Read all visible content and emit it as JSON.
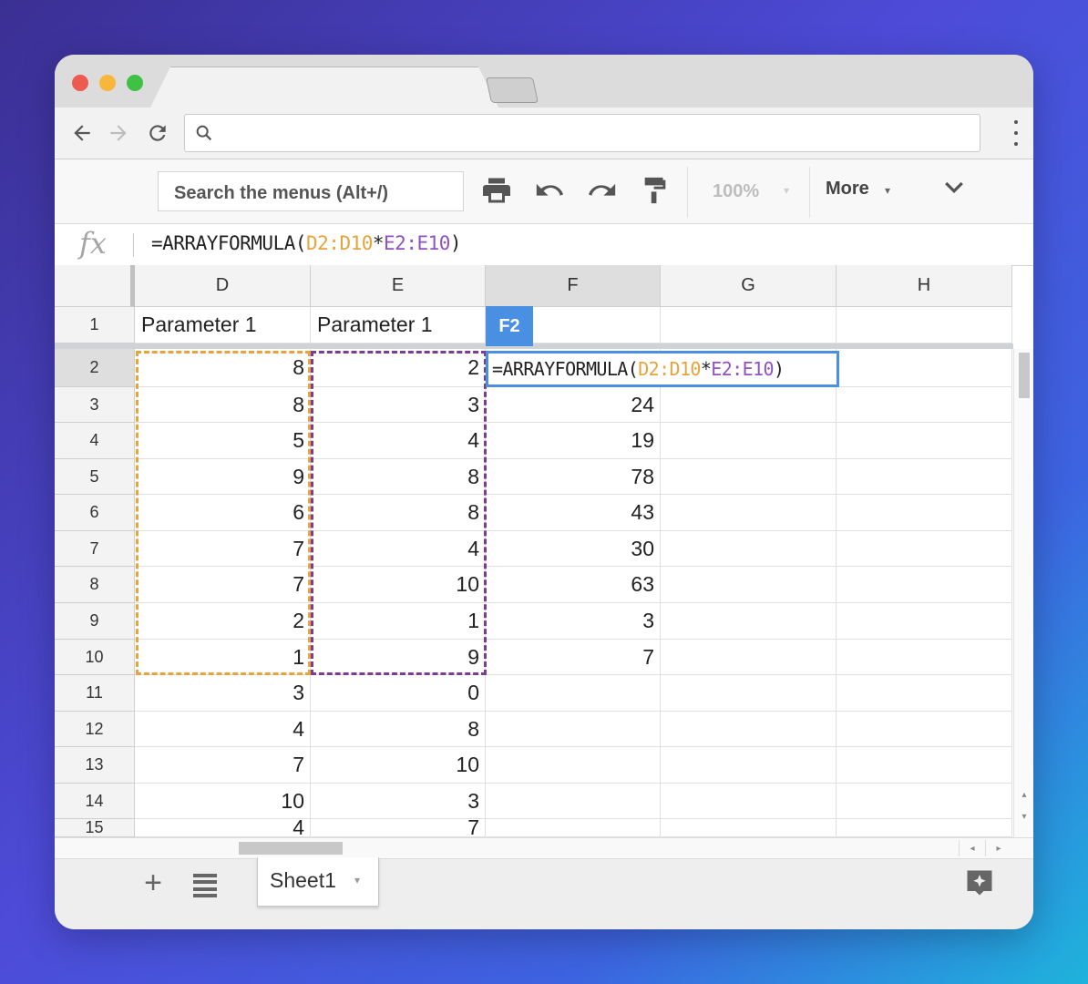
{
  "toolbar": {
    "menu_search_placeholder": "Search the menus (Alt+/)",
    "zoom": "100%",
    "more_label": "More"
  },
  "formula_bar": {
    "prefix": "=ARRAYFORMULA(",
    "range_a": "D2:D10",
    "operator": "*",
    "range_b": "E2:E10",
    "suffix": ")"
  },
  "columns": [
    "D",
    "E",
    "F",
    "G",
    "H"
  ],
  "selected_column": "F",
  "active_cell": "F2",
  "rows": [
    {
      "n": "1",
      "D": "Parameter 1",
      "E": "Parameter 1",
      "F": ""
    },
    {
      "n": "2",
      "D": "8",
      "E": "2",
      "F": ""
    },
    {
      "n": "3",
      "D": "8",
      "E": "3",
      "F": "24"
    },
    {
      "n": "4",
      "D": "5",
      "E": "4",
      "F": "19"
    },
    {
      "n": "5",
      "D": "9",
      "E": "8",
      "F": "78"
    },
    {
      "n": "6",
      "D": "6",
      "E": "8",
      "F": "43"
    },
    {
      "n": "7",
      "D": "7",
      "E": "4",
      "F": "30"
    },
    {
      "n": "8",
      "D": "7",
      "E": "10",
      "F": "63"
    },
    {
      "n": "9",
      "D": "2",
      "E": "1",
      "F": "3"
    },
    {
      "n": "10",
      "D": "1",
      "E": "9",
      "F": "7"
    },
    {
      "n": "11",
      "D": "3",
      "E": "0",
      "F": ""
    },
    {
      "n": "12",
      "D": "4",
      "E": "8",
      "F": ""
    },
    {
      "n": "13",
      "D": "7",
      "E": "10",
      "F": ""
    },
    {
      "n": "14",
      "D": "10",
      "E": "3",
      "F": ""
    },
    {
      "n": "15",
      "D": "4",
      "E": "7",
      "F": ""
    }
  ],
  "sheet_tab": "Sheet1",
  "colors": {
    "range_d": "#e8a33a",
    "range_e": "#7a3c94",
    "active_border": "#4a90e2"
  },
  "icons": [
    "back-icon",
    "forward-icon",
    "reload-icon",
    "search-icon",
    "kebab-menu-icon",
    "print-icon",
    "undo-icon",
    "redo-icon",
    "paint-format-icon",
    "chevron-down-icon",
    "add-sheet-icon",
    "all-sheets-icon",
    "explore-icon"
  ]
}
